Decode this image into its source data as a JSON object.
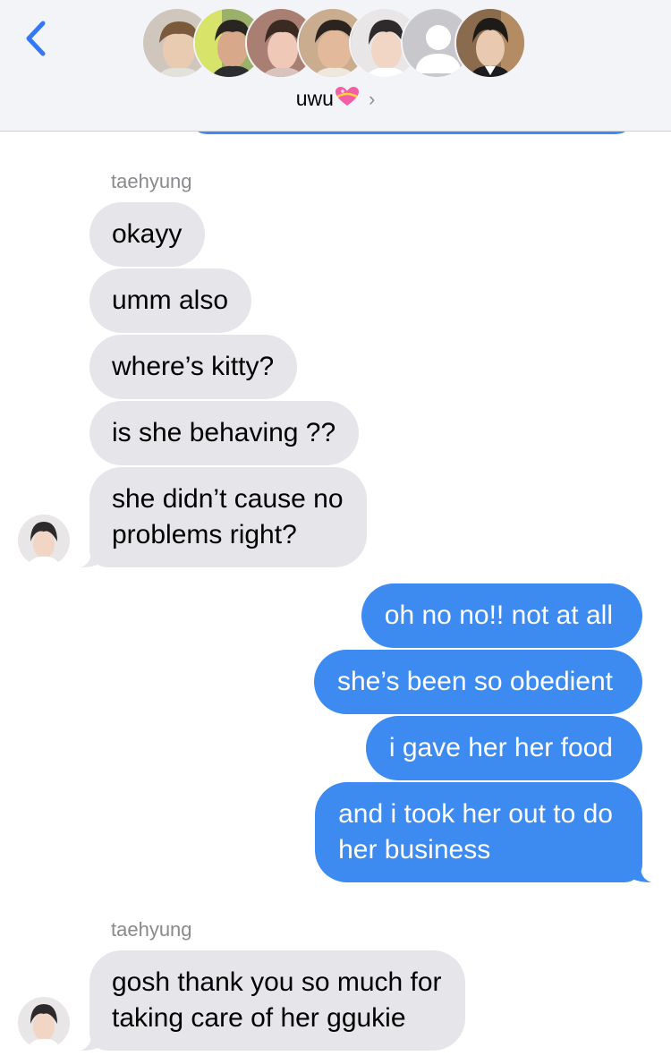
{
  "header": {
    "back_icon": "chevron-left-icon",
    "group_name": "uwu",
    "group_emoji_icon": "heart-with-ribbon-icon",
    "chevron": "›",
    "avatars": [
      {
        "name": "member-1",
        "skin": "#e9cbb2",
        "hair": "#7a5a3a",
        "bg": "#cfc7bd"
      },
      {
        "name": "member-2",
        "skin": "#d7a98a",
        "hair": "#2b2522",
        "bg": "#9bb16a"
      },
      {
        "name": "member-3",
        "skin": "#f0c8b8",
        "hair": "#3a2a22",
        "bg": "#a97f73"
      },
      {
        "name": "member-4",
        "skin": "#e2b99a",
        "hair": "#2a2320",
        "bg": "#c9ad8e"
      },
      {
        "name": "member-5",
        "skin": "#f1d6c6",
        "hair": "#2e2a2c",
        "bg": "#e8e6e6"
      },
      {
        "name": "member-6-placeholder",
        "skin": "#ffffff",
        "hair": "#ffffff",
        "bg": "#c7c7cc"
      },
      {
        "name": "member-7",
        "skin": "#e9c9b0",
        "hair": "#1e1a18",
        "bg": "#8b6b4e"
      }
    ]
  },
  "colors": {
    "incoming_bubble": "#e5e5ea",
    "outgoing_bubble": "#3d8bf0",
    "header_bg": "#f3f4f8",
    "ios_blue": "#3478f6"
  },
  "messages": [
    {
      "type": "sender",
      "text": "taehyung"
    },
    {
      "type": "in",
      "text": "okayy"
    },
    {
      "type": "in",
      "text": "umm also"
    },
    {
      "type": "in",
      "text": "where’s kitty?"
    },
    {
      "type": "in",
      "text": "is she behaving ??"
    },
    {
      "type": "in",
      "lines": [
        "she didn’t cause no",
        "problems right?"
      ]
    },
    {
      "type": "out",
      "text": "oh no no!! not at all"
    },
    {
      "type": "out",
      "text": "she’s been so obedient"
    },
    {
      "type": "out",
      "text": "i gave her her food"
    },
    {
      "type": "out",
      "lines": [
        "and i took her out to do",
        "her business"
      ]
    },
    {
      "type": "sender",
      "text": "taehyung"
    },
    {
      "type": "in",
      "lines": [
        "gosh thank you so much for",
        "taking care of her ggukie"
      ]
    }
  ]
}
